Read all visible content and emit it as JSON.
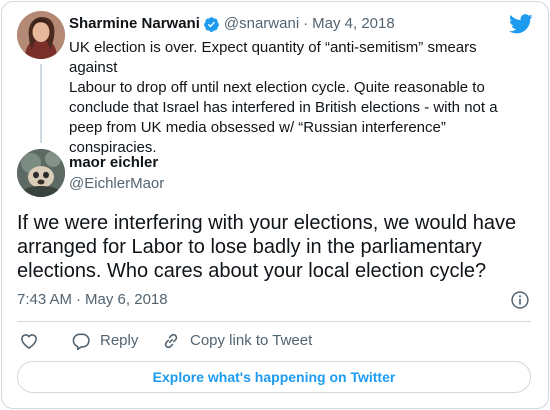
{
  "parent_tweet": {
    "name": "Sharmine Narwani",
    "handle": "@snarwani",
    "separator": "·",
    "date": "May 4, 2018",
    "lines": [
      "UK election is over. Expect quantity of “anti-semitism” smears against",
      "Labour to drop off until next election cycle. Quite reasonable to",
      "conclude that Israel has interfered in British elections - with not a",
      "peep from UK media obsessed w/  “Russian interference”",
      "conspiracies."
    ],
    "verified_icon": "verified-badge-icon",
    "avatar": "profile-photo"
  },
  "main_tweet": {
    "name": "maor eichler",
    "handle": "@EichlerMaor",
    "lines": [
      "If we were interfering with your elections, we would have",
      "arranged for Labor to lose badly in the parliamentary",
      "elections. Who cares about your local election cycle?"
    ],
    "time": "7:43 AM",
    "separator": "·",
    "date": "May 6, 2018",
    "avatar": "profile-photo"
  },
  "actions": {
    "reply_label": "Reply",
    "copy_label": "Copy link to Tweet",
    "like_icon": "heart-icon",
    "reply_icon": "speech-bubble-icon",
    "copy_icon": "link-icon"
  },
  "explore_button": "Explore what's happening on Twitter",
  "colors": {
    "accent": "#1d9bf0",
    "text": "#0f1419",
    "secondary": "#536471",
    "border": "#cfd9de"
  }
}
